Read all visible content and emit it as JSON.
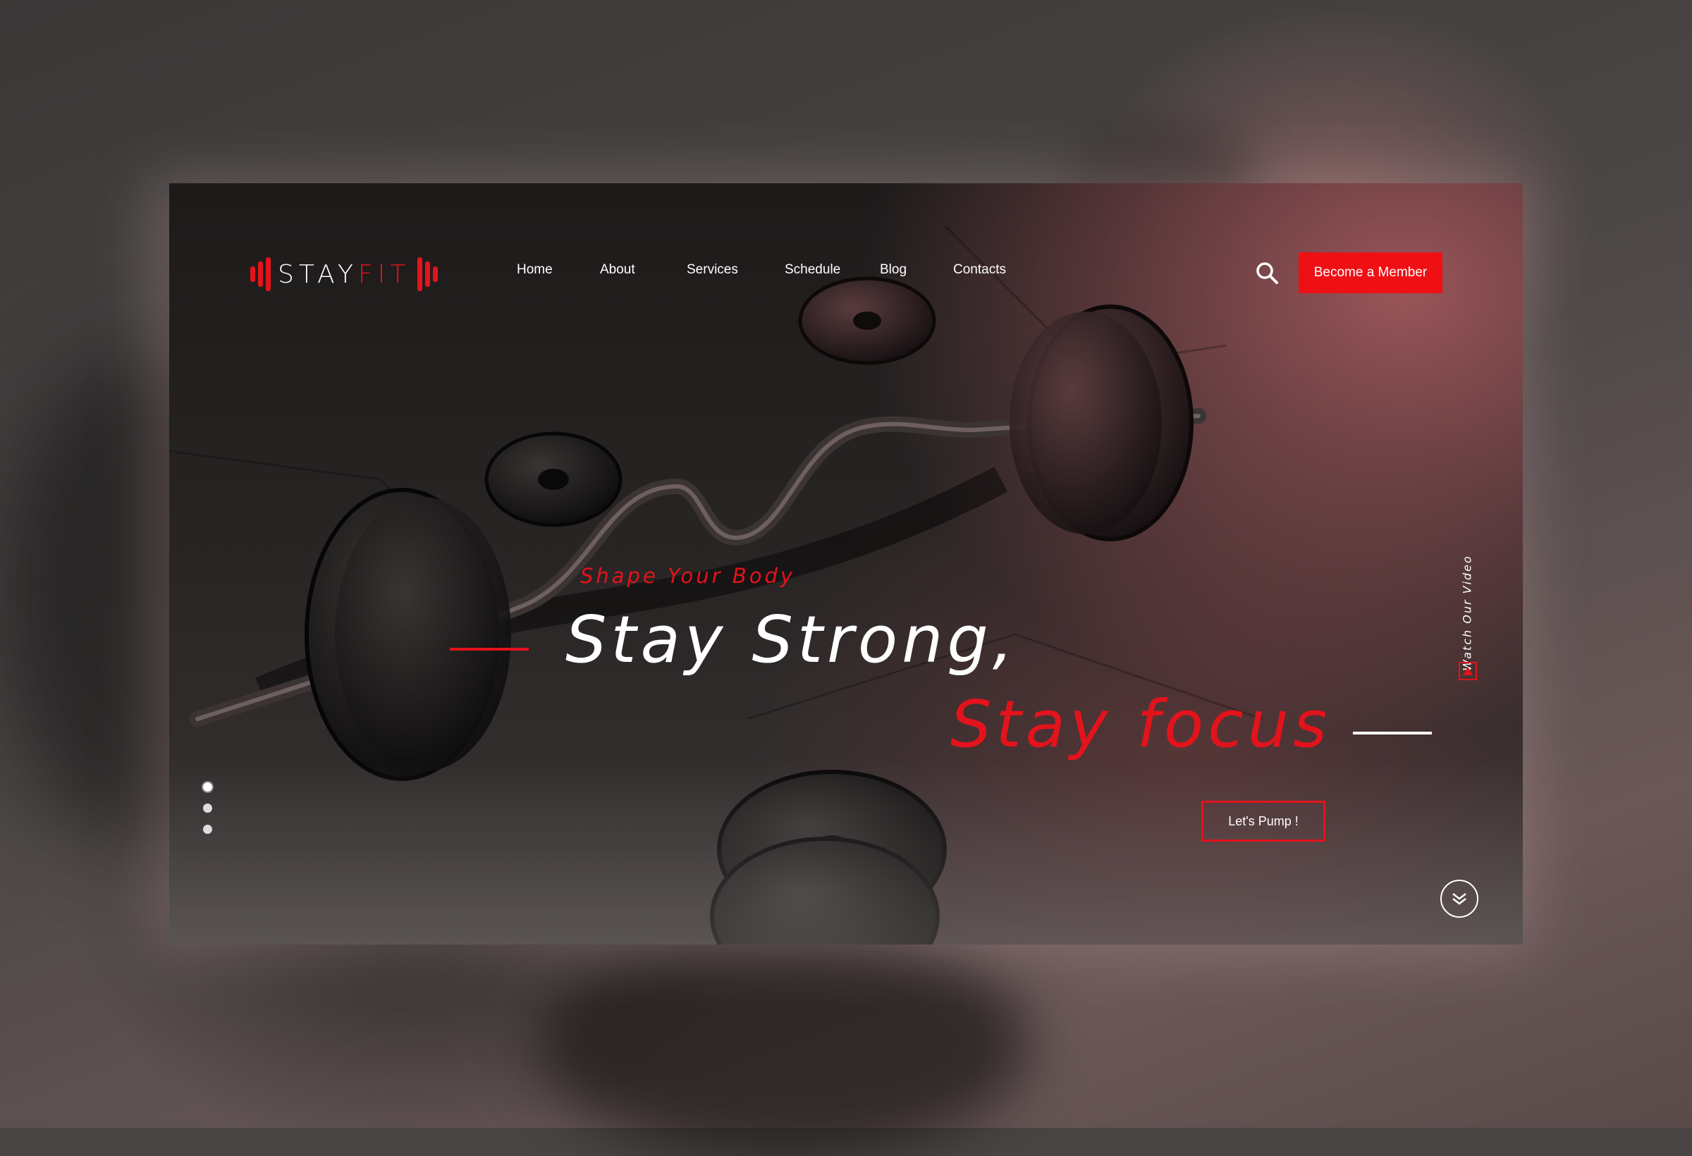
{
  "brand": {
    "part1": "STAY",
    "part2": "FIT"
  },
  "nav": {
    "items": [
      "Home",
      "About",
      "Services",
      "Schedule",
      "Blog",
      "Contacts"
    ]
  },
  "header": {
    "cta_label": "Become a Member"
  },
  "hero": {
    "subtitle": "Shape Your Body",
    "headline_line1": "Stay Strong,",
    "headline_line2": "Stay focus",
    "cta_label": "Let's Pump !"
  },
  "video": {
    "label": "Watch Our Video"
  },
  "slider": {
    "total": 3,
    "active": 1
  },
  "colors": {
    "accent": "#e3131c",
    "button": "#ef1016",
    "text": "#ffffff"
  },
  "icons": [
    "search-icon",
    "play-icon",
    "chevron-down-icon"
  ]
}
